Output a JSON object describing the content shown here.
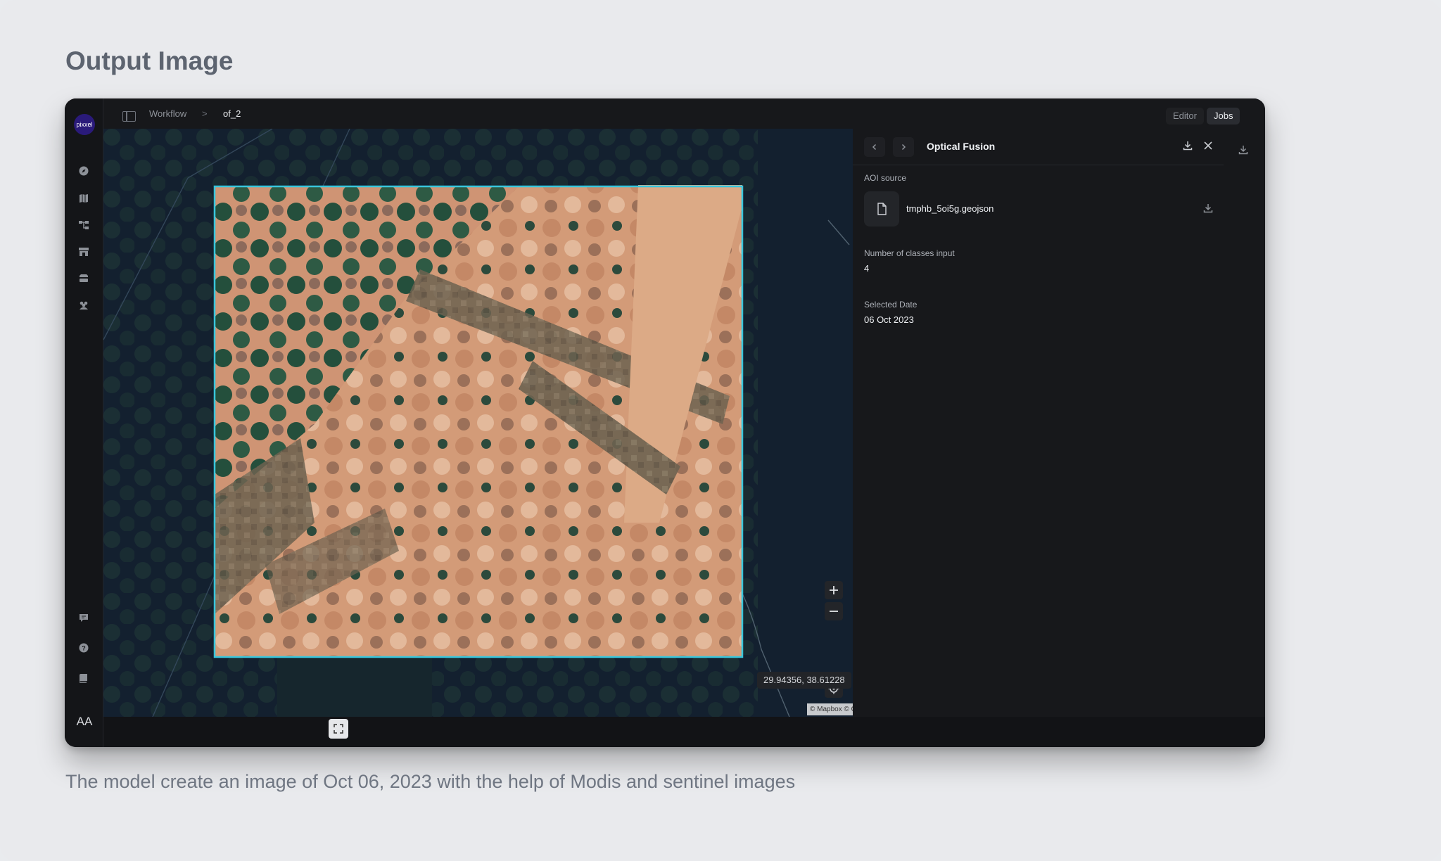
{
  "page": {
    "heading": "Output Image",
    "caption": "The model create an image of Oct 06, 2023 with the help of Modis and sentinel images"
  },
  "app": {
    "logo_text": "pixxel",
    "breadcrumb": {
      "root": "Workflow",
      "separator": ">",
      "current": "of_2"
    },
    "mode_tabs": [
      {
        "label": "Editor",
        "active": false
      },
      {
        "label": "Jobs",
        "active": true
      }
    ],
    "sidebar_icons": [
      "explore-icon",
      "map-icon",
      "workflow-icon",
      "store-icon",
      "storage-icon",
      "team-icon"
    ],
    "sidebar_bottom_icons": [
      "feedback-icon",
      "help-icon",
      "docs-icon"
    ],
    "avatar_initials": "AA"
  },
  "panel": {
    "title": "Optical Fusion",
    "fields": {
      "aoi_source_label": "AOI source",
      "aoi_file": "tmphb_5oi5g.geojson",
      "classes_label": "Number of classes input",
      "classes_value": "4",
      "date_label": "Selected Date",
      "date_value": "06 Oct 2023"
    }
  },
  "map": {
    "coordinates": "29.94356, 38.61228",
    "compass_label": "N",
    "attribution": "© Mapbox © OpenStreetMap"
  },
  "colors": {
    "accent_selection": "#38c6dc",
    "desert": "#d39b78",
    "map_water": "#13202f"
  }
}
